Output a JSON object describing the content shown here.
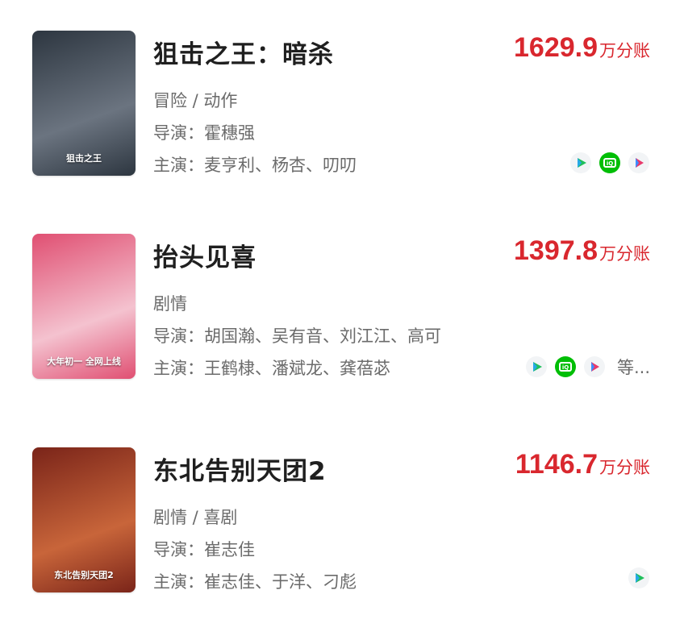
{
  "movies": [
    {
      "title": "狙击之王：暗杀",
      "box_value": "1629.9",
      "box_unit": "万分账",
      "genre": "冒险 / 动作",
      "director": "导演：霍穗强",
      "cast": "主演：麦亨利、杨杏、叨叨",
      "poster_colors": [
        "#2d3640",
        "#6b7480"
      ],
      "poster_logo": "狙击之王",
      "platforms": [
        "tencent-video-icon",
        "iqiyi-icon",
        "youku-icon"
      ],
      "more_label": ""
    },
    {
      "title": "抬头见喜",
      "box_value": "1397.8",
      "box_unit": "万分账",
      "genre": "剧情",
      "director": "导演：胡国瀚、吴有音、刘江江、高可",
      "cast": "主演：王鹤棣、潘斌龙、龚蓓苾",
      "poster_colors": [
        "#e04f72",
        "#f4c2cf"
      ],
      "poster_logo": "大年初一 全网上线",
      "platforms": [
        "tencent-video-icon",
        "iqiyi-icon",
        "youku-icon"
      ],
      "more_label": "等..."
    },
    {
      "title": "东北告别天团2",
      "box_value": "1146.7",
      "box_unit": "万分账",
      "genre": "剧情 / 喜剧",
      "director": "导演：崔志佳",
      "cast": "主演：崔志佳、于洋、刁彪",
      "poster_colors": [
        "#7a2419",
        "#c8653a"
      ],
      "poster_logo": "东北告别天团2",
      "platforms": [
        "tencent-video-icon"
      ],
      "more_label": ""
    }
  ],
  "colors": {
    "accent": "#d9272e",
    "muted": "#6b6b6b",
    "tencent": "#1fbf5c",
    "iqiyi": "#00be06",
    "youku": "#e8396b"
  }
}
